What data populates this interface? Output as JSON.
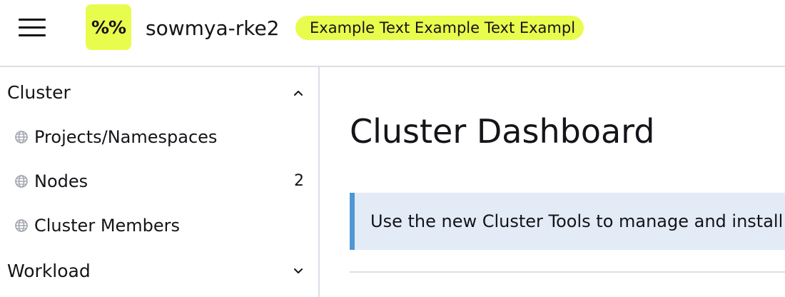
{
  "header": {
    "logo_text": "%%",
    "cluster_name": "sowmya-rke2",
    "badge_text": "Example Text Example Text Exampl",
    "logo_color": "#e8fc4d",
    "badge_color": "#e8fc4d"
  },
  "sidebar": {
    "groups": [
      {
        "label": "Cluster",
        "expanded": true,
        "icon": "chevron-up-icon",
        "items": [
          {
            "label": "Projects/Namespaces",
            "icon": "globe-icon",
            "count": ""
          },
          {
            "label": "Nodes",
            "icon": "globe-icon",
            "count": "2"
          },
          {
            "label": "Cluster Members",
            "icon": "globe-icon",
            "count": ""
          }
        ]
      },
      {
        "label": "Workload",
        "expanded": false,
        "icon": "chevron-down-icon",
        "items": []
      }
    ]
  },
  "main": {
    "title": "Cluster Dashboard",
    "banner_text": "Use the new Cluster Tools to manage and install",
    "banner_accent": "#4f96d4"
  }
}
